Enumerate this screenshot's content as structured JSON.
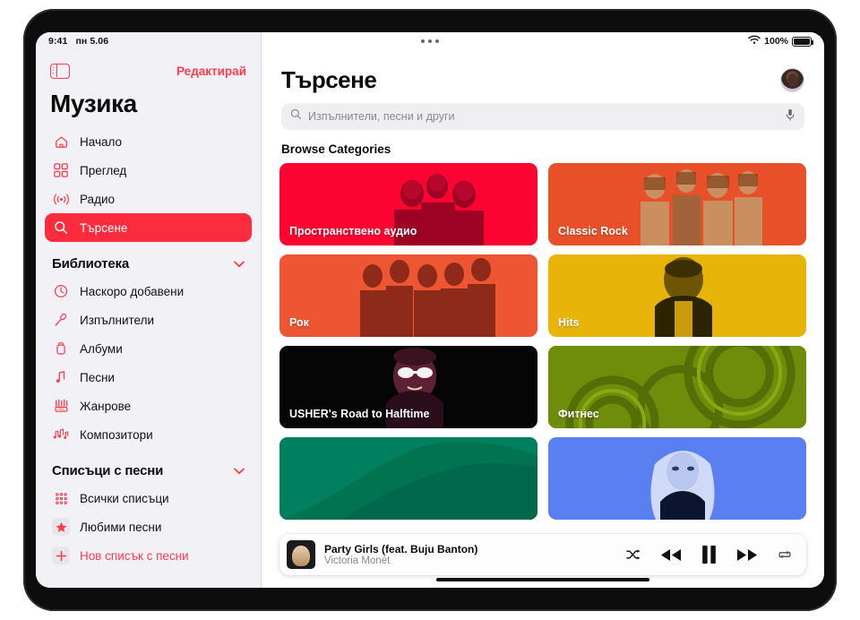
{
  "status_bar": {
    "time": "9:41",
    "date": "пн 5.06",
    "battery_percent": "100%",
    "wifi_icon": "wifi-icon",
    "battery_icon": "battery-icon",
    "multitask_icon": "multitask-dots-icon"
  },
  "sidebar": {
    "toggle_icon": "sidebar-toggle-icon",
    "edit_label": "Редактирай",
    "title": "Музика",
    "nav_items": [
      {
        "label": "Начало",
        "icon": "home-icon",
        "selected": false
      },
      {
        "label": "Преглед",
        "icon": "grid-icon",
        "selected": false
      },
      {
        "label": "Радио",
        "icon": "radio-icon",
        "selected": false
      },
      {
        "label": "Търсене",
        "icon": "search-icon",
        "selected": true
      }
    ],
    "library_section": {
      "title": "Библиотека",
      "chevron": "chevron-down-icon"
    },
    "library_items": [
      {
        "label": "Наскоро добавени",
        "icon": "clock-icon"
      },
      {
        "label": "Изпълнители",
        "icon": "microphone-icon"
      },
      {
        "label": "Албуми",
        "icon": "album-icon"
      },
      {
        "label": "Песни",
        "icon": "music-note-icon"
      },
      {
        "label": "Жанрове",
        "icon": "genres-icon"
      },
      {
        "label": "Композитори",
        "icon": "composers-icon"
      }
    ],
    "playlists_section": {
      "title": "Списъци с песни",
      "chevron": "chevron-down-icon"
    },
    "playlist_items": [
      {
        "label": "Всички списъци",
        "icon": "playlists-grid-icon",
        "accent": false
      },
      {
        "label": "Любими песни",
        "icon": "star-icon",
        "accent": false
      },
      {
        "label": "Нов списък с песни",
        "icon": "plus-icon",
        "accent": true
      }
    ]
  },
  "main": {
    "title": "Търсене",
    "avatar": "user-avatar",
    "search": {
      "placeholder": "Изпълнители, песни и други",
      "search_icon": "search-icon",
      "mic_icon": "microphone-icon"
    },
    "section_label": "Browse Categories",
    "categories": [
      {
        "label": "Пространствено аудио",
        "color": "#fc0431",
        "art": "rap-group-photo"
      },
      {
        "label": "Classic Rock",
        "color": "#e8502a",
        "art": "classic-rock-band-photo"
      },
      {
        "label": "Рок",
        "color": "#ee5532",
        "art": "rock-band-photo"
      },
      {
        "label": "Hits",
        "color": "#e9b40a",
        "art": "drake-portrait-photo"
      },
      {
        "label": "USHER's Road to Halftime",
        "color": "#050505",
        "art": "usher-portrait-photo"
      },
      {
        "label": "Фитнес",
        "color": "#6f8c0a",
        "art": "fitness-weights-photo"
      },
      {
        "label": "",
        "color": "#00805e",
        "art": "green-abstract-photo"
      },
      {
        "label": "",
        "color": "#5a7ff0",
        "art": "blonde-artist-photo"
      }
    ]
  },
  "now_playing": {
    "artwork": "album-artwork",
    "track_title": "Party Girls (feat. Buju Banton)",
    "artist": "Victoria Monét",
    "controls": [
      {
        "name": "shuffle-button",
        "icon": "shuffle-icon"
      },
      {
        "name": "rewind-button",
        "icon": "rewind-icon"
      },
      {
        "name": "pause-button",
        "icon": "pause-icon"
      },
      {
        "name": "fast-forward-button",
        "icon": "fast-forward-icon"
      },
      {
        "name": "repeat-button",
        "icon": "repeat-icon"
      }
    ]
  },
  "colors": {
    "accent": "#ff3b4e",
    "selected_bg": "#fb2c3e",
    "sidebar_bg": "#f2f2f6"
  }
}
